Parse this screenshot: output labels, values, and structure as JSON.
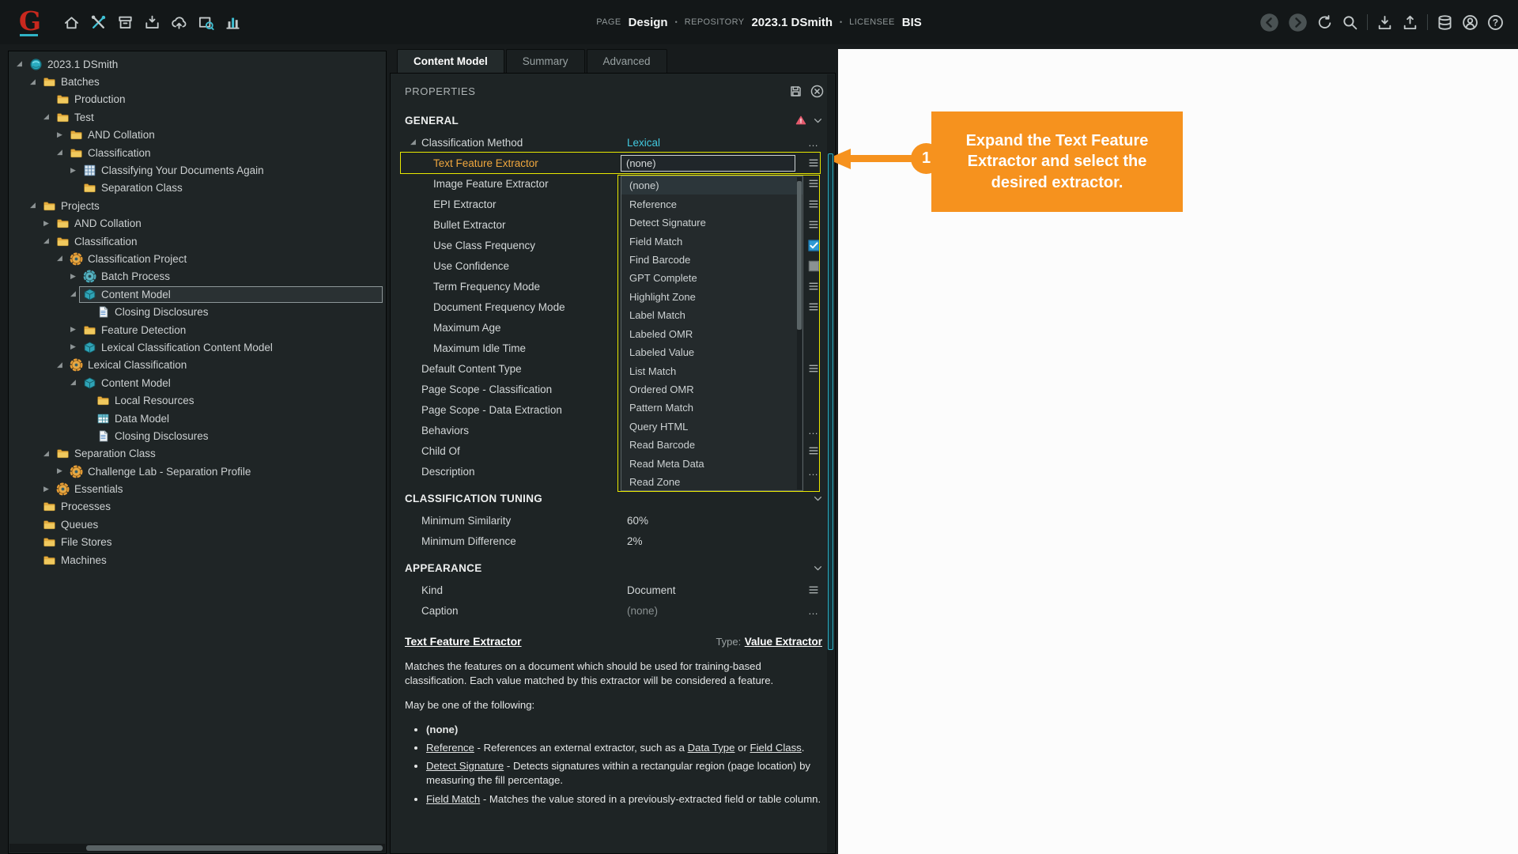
{
  "colors": {
    "accent_teal": "#3fc0d4",
    "link_teal": "#41c9df",
    "highlight_yellow": "#e8e800",
    "callout_orange": "#f6921e",
    "warning_red": "#e45a6d",
    "label_orange": "#f0a73e"
  },
  "topbar": {
    "logo": "G",
    "left_icons": [
      "home",
      "tools",
      "archive",
      "import",
      "cloud-upload",
      "box-search",
      "bar-chart"
    ],
    "meta": [
      {
        "label": "PAGE",
        "value": "Design"
      },
      {
        "label": "REPOSITORY",
        "value": "2023.1 DSmith"
      },
      {
        "label": "LICENSEE",
        "value": "BIS"
      }
    ],
    "separator": "•",
    "right_icons": [
      "back",
      "forward",
      "refresh",
      "search",
      "divider",
      "download",
      "upload",
      "divider",
      "database",
      "user",
      "help"
    ]
  },
  "tree": {
    "items": [
      {
        "label": "2023.1 DSmith",
        "level": 0,
        "icon": "root",
        "exp": "open",
        "selected": false
      },
      {
        "label": "Batches",
        "level": 1,
        "icon": "folder",
        "exp": "open",
        "selected": false
      },
      {
        "label": "Production",
        "level": 2,
        "icon": "folder",
        "exp": "none",
        "selected": false
      },
      {
        "label": "Test",
        "level": 2,
        "icon": "folder",
        "exp": "open",
        "selected": false
      },
      {
        "label": "AND Collation",
        "level": 3,
        "icon": "folder",
        "exp": "closed",
        "selected": false
      },
      {
        "label": "Classification",
        "level": 3,
        "icon": "folder",
        "exp": "open",
        "selected": false
      },
      {
        "label": "Classifying Your Documents Again",
        "level": 4,
        "icon": "batch",
        "exp": "closed",
        "selected": false
      },
      {
        "label": "Separation Class",
        "level": 4,
        "icon": "folder",
        "exp": "none",
        "selected": false
      },
      {
        "label": "Projects",
        "level": 1,
        "icon": "folder",
        "exp": "open",
        "selected": false
      },
      {
        "label": "AND Collation",
        "level": 2,
        "icon": "folder",
        "exp": "closed",
        "selected": false
      },
      {
        "label": "Classification",
        "level": 2,
        "icon": "folder",
        "exp": "open",
        "selected": false
      },
      {
        "label": "Classification Project",
        "level": 3,
        "icon": "project",
        "exp": "open",
        "selected": false
      },
      {
        "label": "Batch Process",
        "level": 4,
        "icon": "process",
        "exp": "closed",
        "selected": false
      },
      {
        "label": "Content Model",
        "level": 4,
        "icon": "content-model",
        "exp": "open",
        "selected": true
      },
      {
        "label": "Closing Disclosures",
        "level": 5,
        "icon": "document",
        "exp": "none",
        "selected": false
      },
      {
        "label": "Feature Detection",
        "level": 4,
        "icon": "folder",
        "exp": "closed",
        "selected": false
      },
      {
        "label": "Lexical Classification Content Model",
        "level": 4,
        "icon": "content-model",
        "exp": "closed",
        "selected": false
      },
      {
        "label": "Lexical Classification",
        "level": 3,
        "icon": "project",
        "exp": "open",
        "selected": false
      },
      {
        "label": "Content Model",
        "level": 4,
        "icon": "content-model",
        "exp": "open",
        "selected": false
      },
      {
        "label": "Local Resources",
        "level": 5,
        "icon": "folder",
        "exp": "none",
        "selected": false
      },
      {
        "label": "Data Model",
        "level": 5,
        "icon": "datamodel",
        "exp": "none",
        "selected": false
      },
      {
        "label": "Closing Disclosures",
        "level": 5,
        "icon": "document",
        "exp": "none",
        "selected": false
      },
      {
        "label": "Separation Class",
        "level": 2,
        "icon": "folder",
        "exp": "open",
        "selected": false
      },
      {
        "label": "Challenge Lab - Separation Profile",
        "level": 3,
        "icon": "project",
        "exp": "closed",
        "selected": false
      },
      {
        "label": "Essentials",
        "level": 2,
        "icon": "project",
        "exp": "closed",
        "selected": false
      },
      {
        "label": "Processes",
        "level": 1,
        "icon": "folder",
        "exp": "none",
        "selected": false
      },
      {
        "label": "Queues",
        "level": 1,
        "icon": "folder",
        "exp": "none",
        "selected": false
      },
      {
        "label": "File Stores",
        "level": 1,
        "icon": "folder",
        "exp": "none",
        "selected": false
      },
      {
        "label": "Machines",
        "level": 1,
        "icon": "folder",
        "exp": "none",
        "selected": false
      }
    ]
  },
  "tabs": [
    {
      "label": "Content Model",
      "active": true
    },
    {
      "label": "Summary",
      "active": false
    },
    {
      "label": "Advanced",
      "active": false
    }
  ],
  "properties": {
    "title": "PROPERTIES",
    "sections": [
      {
        "name": "GENERAL",
        "warning": true,
        "rows": [
          {
            "label": "Classification Method",
            "level": 1,
            "expander": true,
            "value": "Lexical",
            "style": "link",
            "righticon": "ellipsis"
          },
          {
            "label": "Text Feature Extractor",
            "level": 2,
            "highlight": true,
            "combo": "(none)",
            "righticon": "menu"
          },
          {
            "label": "Image Feature Extractor",
            "level": 2,
            "righticon": "menu"
          },
          {
            "label": "EPI Extractor",
            "level": 2,
            "righticon": "menu"
          },
          {
            "label": "Bullet Extractor",
            "level": 2,
            "righticon": "menu"
          },
          {
            "label": "Use Class Frequency",
            "level": 2,
            "righticon": "checkbox-on"
          },
          {
            "label": "Use Confidence",
            "level": 2,
            "righticon": "checkbox-off"
          },
          {
            "label": "Term Frequency Mode",
            "level": 2,
            "righticon": "menu"
          },
          {
            "label": "Document Frequency Mode",
            "level": 2,
            "righticon": "menu"
          },
          {
            "label": "Maximum Age",
            "level": 2
          },
          {
            "label": "Maximum Idle Time",
            "level": 2
          },
          {
            "label": "Default Content Type",
            "level": 1,
            "righticon": "menu"
          },
          {
            "label": "Page Scope - Classification",
            "level": 1
          },
          {
            "label": "Page Scope - Data Extraction",
            "level": 1
          },
          {
            "label": "Behaviors",
            "level": 1,
            "righticon": "ellipsis"
          },
          {
            "label": "Child Of",
            "level": 1,
            "righticon": "menu"
          },
          {
            "label": "Description",
            "level": 1,
            "righticon": "ellipsis"
          }
        ]
      },
      {
        "name": "CLASSIFICATION TUNING",
        "warning": false,
        "rows": [
          {
            "label": "Minimum Similarity",
            "level": 1,
            "value": "60%"
          },
          {
            "label": "Minimum Difference",
            "level": 1,
            "value": "2%"
          }
        ]
      },
      {
        "name": "APPEARANCE",
        "warning": false,
        "rows": [
          {
            "label": "Kind",
            "level": 1,
            "value": "Document",
            "righticon": "menu"
          },
          {
            "label": "Caption",
            "level": 1,
            "value": "(none)",
            "style": "muted",
            "righticon": "ellipsis"
          }
        ]
      }
    ]
  },
  "dropdown": {
    "selected_index": 0,
    "items": [
      "(none)",
      "Reference",
      "Detect Signature",
      "Field Match",
      "Find Barcode",
      "GPT Complete",
      "Highlight Zone",
      "Label Match",
      "Labeled OMR",
      "Labeled Value",
      "List Match",
      "Ordered OMR",
      "Pattern Match",
      "Query HTML",
      "Read Barcode",
      "Read Meta Data",
      "Read Zone"
    ]
  },
  "help": {
    "title": "Text Feature Extractor",
    "type_label": "Type:",
    "type_value": "Value Extractor",
    "p1": "Matches the features on a document which should be used for training-based classification. Each value matched by this extractor will be considered a feature.",
    "p2": "May be one of the following:",
    "bullets": [
      [
        {
          "t": "(none)",
          "b": true
        }
      ],
      [
        {
          "t": "Reference",
          "u": true
        },
        {
          "t": " - References an external extractor, such as a "
        },
        {
          "t": "Data Type",
          "u": true
        },
        {
          "t": " or "
        },
        {
          "t": "Field Class",
          "u": true
        },
        {
          "t": "."
        }
      ],
      [
        {
          "t": "Detect Signature",
          "u": true
        },
        {
          "t": " - Detects signatures within a rectangular region (page location) by measuring the fill percentage."
        }
      ],
      [
        {
          "t": "Field Match",
          "u": true
        },
        {
          "t": " - Matches the value stored in a previously-extracted field or table column."
        }
      ]
    ]
  },
  "callout": {
    "number": "1",
    "text": "Expand the Text Feature Extractor and select the desired extractor."
  }
}
